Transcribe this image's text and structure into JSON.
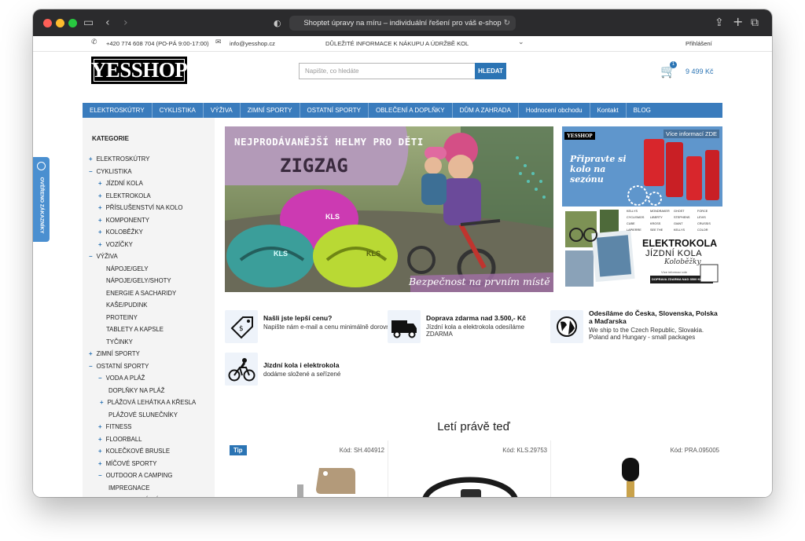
{
  "browser": {
    "url_title": "Shoptet úpravy na míru – individuální řešení pro váš e-shop"
  },
  "topbar": {
    "phone": "+420 774 608 704 (PO-PÁ 9:00-17:00)",
    "email": "info@yesshop.cz",
    "info": "DŮLEŽITÉ INFORMACE K NÁKUPU A ÚDRŽBĚ KOL",
    "login": "Přihlášení"
  },
  "header": {
    "logo": "YESSHOP",
    "search_placeholder": "Napište, co hledáte",
    "search_button": "HLEDAT",
    "cart_count": "1",
    "cart_total": "9 499 Kč"
  },
  "nav": [
    "ELEKTROSKÚTRY",
    "CYKLISTIKA",
    "VÝŽIVA",
    "ZIMNÍ SPORTY",
    "OSTATNÍ SPORTY",
    "OBLEČENÍ A DOPLŇKY",
    "DŮM A ZAHRADA",
    "Hodnocení obchodu",
    "Kontakt",
    "BLOG"
  ],
  "review_tab": "OVĚŘENO ZÁKAZNÍKY",
  "sidebar": {
    "title": "KATEGORIE",
    "items": [
      {
        "m": "+",
        "label": "ELEKTROSKÚTRY",
        "lvl": 0
      },
      {
        "m": "−",
        "label": "CYKLISTIKA",
        "lvl": 0
      },
      {
        "m": "+",
        "label": "JÍZDNÍ KOLA",
        "lvl": 1
      },
      {
        "m": "+",
        "label": "ELEKTROKOLA",
        "lvl": 1
      },
      {
        "m": "+",
        "label": "PŘÍSLUŠENSTVÍ NA KOLO",
        "lvl": 1
      },
      {
        "m": "+",
        "label": "KOMPONENTY",
        "lvl": 1
      },
      {
        "m": "+",
        "label": "KOLOBĚŽKY",
        "lvl": 1
      },
      {
        "m": "+",
        "label": "VOZÍČKY",
        "lvl": 1
      },
      {
        "m": "−",
        "label": "VÝŽIVA",
        "lvl": 0
      },
      {
        "m": "",
        "label": "NÁPOJE/GELY",
        "lvl": 2
      },
      {
        "m": "",
        "label": "NÁPOJE/GELY/SHOTY",
        "lvl": 2
      },
      {
        "m": "",
        "label": "ENERGIE A SACHARIDY",
        "lvl": 2
      },
      {
        "m": "",
        "label": "KAŠE/PUDINK",
        "lvl": 2
      },
      {
        "m": "",
        "label": "PROTEINY",
        "lvl": 2
      },
      {
        "m": "",
        "label": "TABLETY A KAPSLE",
        "lvl": 2
      },
      {
        "m": "",
        "label": "TYČINKY",
        "lvl": 2
      },
      {
        "m": "+",
        "label": "ZIMNÍ SPORTY",
        "lvl": 0
      },
      {
        "m": "−",
        "label": "OSTATNÍ SPORTY",
        "lvl": 0
      },
      {
        "m": "−",
        "label": "VODA A PLÁŽ",
        "lvl": 1
      },
      {
        "m": "",
        "label": "DOPLŇKY NA PLÁŽ",
        "lvl": 3
      },
      {
        "m": "+",
        "label": "PLÁŽOVÁ LEHÁTKA A KŘESLA",
        "lvl": 1.4
      },
      {
        "m": "",
        "label": "PLÁŽOVÉ SLUNEČNÍKY",
        "lvl": 3
      },
      {
        "m": "+",
        "label": "FITNESS",
        "lvl": 1
      },
      {
        "m": "+",
        "label": "FLOORBALL",
        "lvl": 1
      },
      {
        "m": "+",
        "label": "KOLEČKOVÉ BRUSLE",
        "lvl": 1
      },
      {
        "m": "+",
        "label": "MÍČOVÉ SPORTY",
        "lvl": 1
      },
      {
        "m": "−",
        "label": "OUTDOOR A CAMPING",
        "lvl": 1
      },
      {
        "m": "",
        "label": "IMPREGNACE",
        "lvl": 3
      },
      {
        "m": "+",
        "label": "CAMPINGOVÝ NÁBYTEK",
        "lvl": 1.4
      }
    ]
  },
  "banner": {
    "headline": "NEJPRODÁVANĚJŠÍ HELMY PRO DĚTI",
    "brand": "ZIGZAG",
    "slogan": "Bezpečnost na prvním místě",
    "helmet_brand": "KLS"
  },
  "side_banner": {
    "logo": "YESSHOP",
    "more_info": "Více informací ZDE",
    "spring": "Připravte si kolo na sezónu",
    "ebike_title": "ELEKTROKOLA",
    "ebike_sub": "JÍZDNÍ KOLA",
    "ebike_script": "Koloběžky",
    "small_note": "Více informací zde",
    "cta": "DOPRAVA ZDARMA NAD 3500 KČ",
    "brands": [
      "KELLYS",
      "MONDRAKER",
      "GHOST",
      "FORCE",
      "CYCLISMOS",
      "LIBERTY",
      "STEPHENS",
      "LEVIS",
      "CUBE",
      "KROSS",
      "GIANT",
      "CRUSSIS",
      "LAPIERRE",
      "SEE THE",
      "KELLYS",
      "COLOR"
    ]
  },
  "usps": [
    {
      "title": "Našli jste lepší cenu?",
      "text": "Napište nám e-mail a cenu minimálně dorovnáme."
    },
    {
      "title": "Doprava zdarma nad 3.500,- Kč",
      "text": "Jízdní kola a elektrokola odesíláme ZDARMA"
    },
    {
      "title": "Odesíláme do Česka, Slovenska, Polska a Maďarska",
      "text": "We ship to the Czech Republic, Slovakia. Poland and Hungary - small packages"
    },
    {
      "title": "Jízdní kola i elektrokola",
      "text": "dodáme složené a seřízené"
    }
  ],
  "section": {
    "title": "Letí právě teď",
    "tip": "Tip"
  },
  "products": [
    {
      "code": "Kód: SH.404912"
    },
    {
      "code": "Kód: KLS.29753"
    },
    {
      "code": "Kód: PRA.095005"
    }
  ],
  "colors": {
    "brand": "#2b74b4",
    "nav": "#3a7cbd"
  }
}
